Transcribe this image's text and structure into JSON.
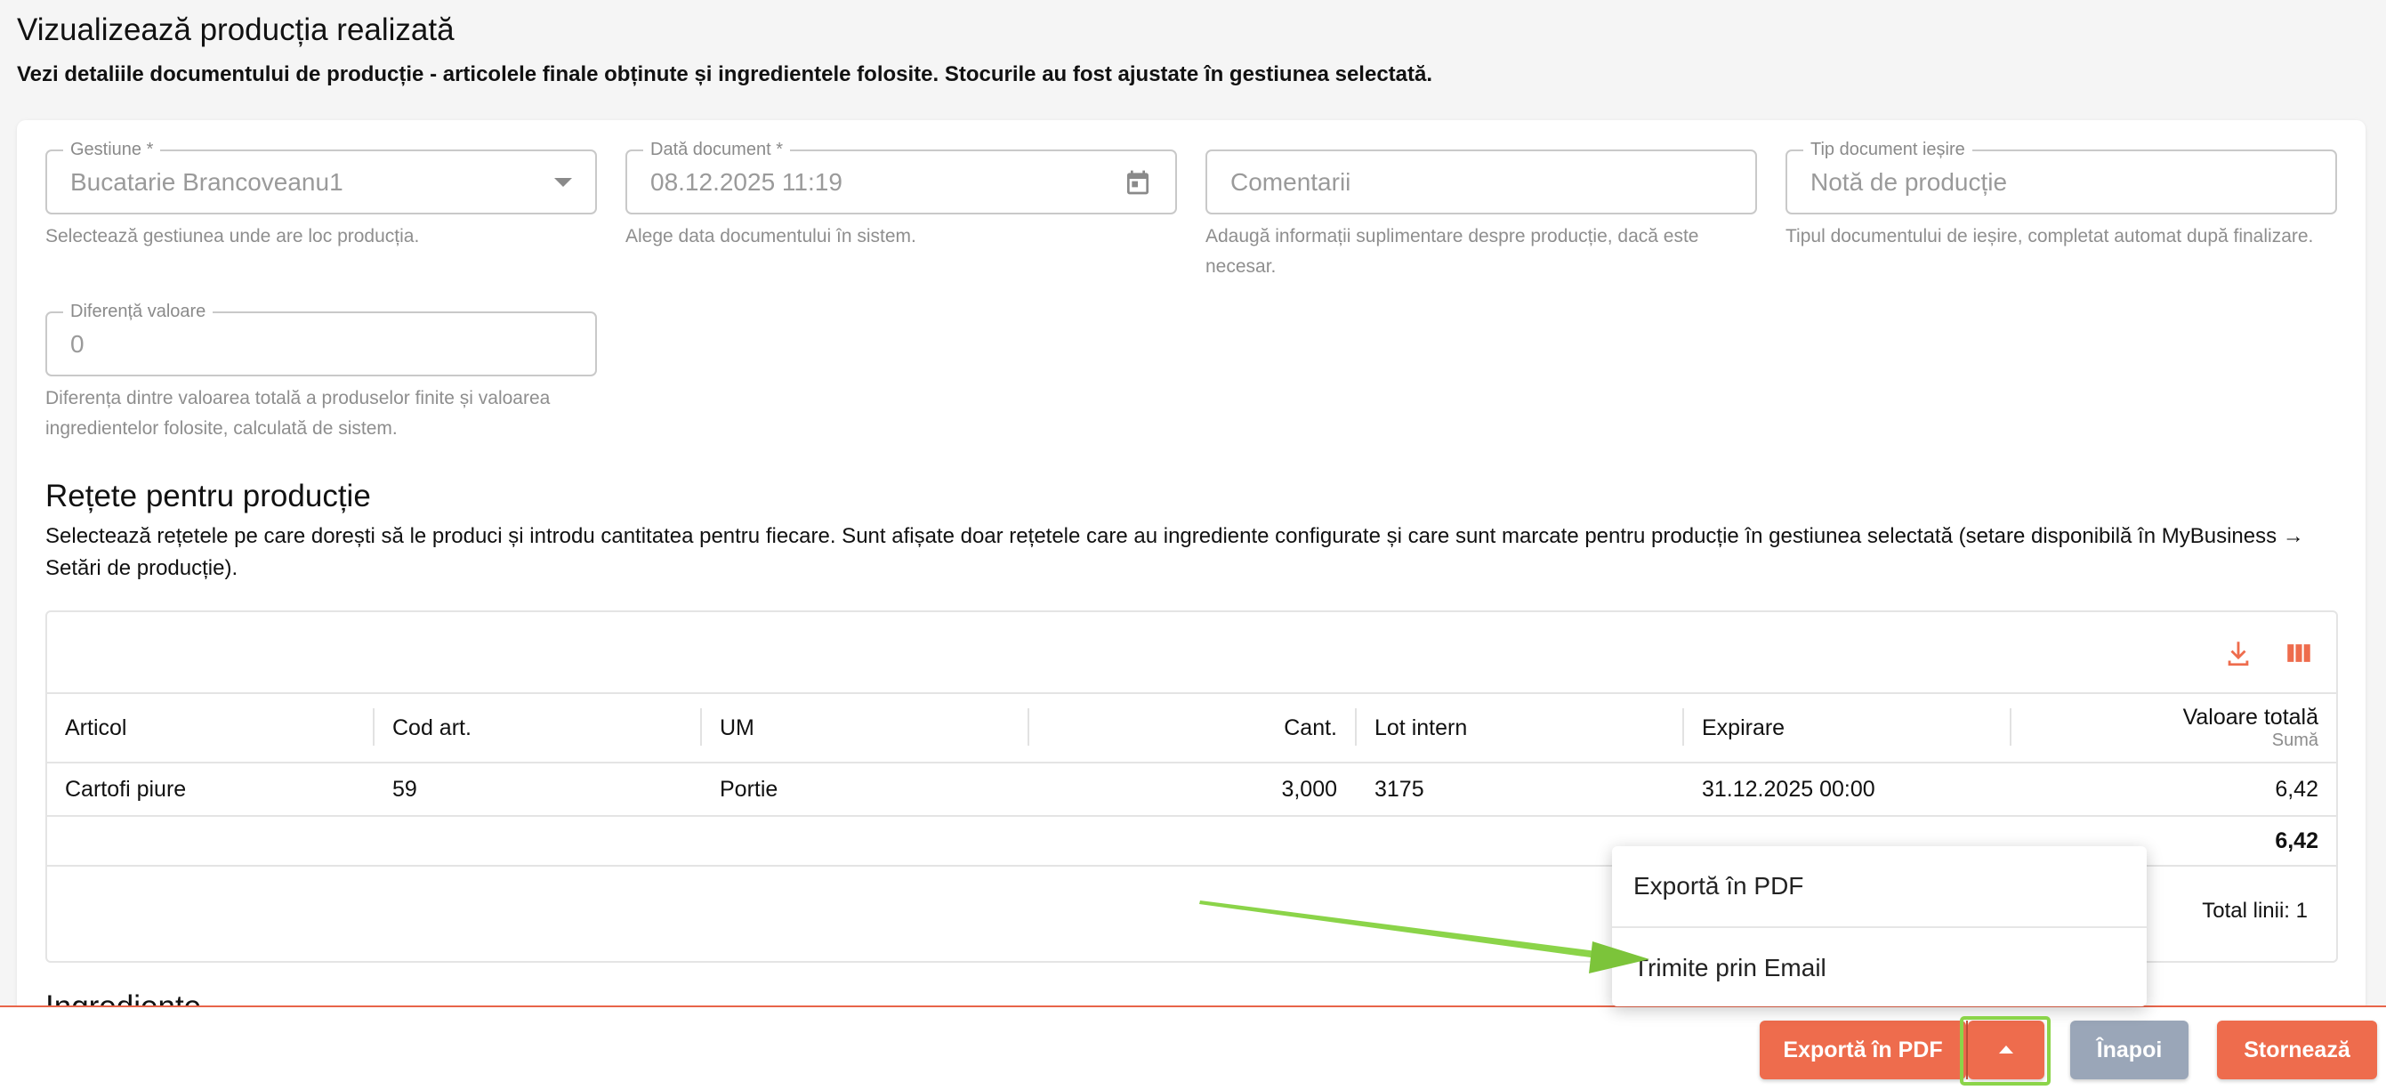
{
  "page": {
    "title": "Vizualizează producția realizată",
    "subtitle": "Vezi detaliile documentului de producție - articolele finale obținute și ingredientele folosite. Stocurile au fost ajustate în gestiunea selectată."
  },
  "form": {
    "gestiune": {
      "label": "Gestiune *",
      "value": "Bucatarie Brancoveanu1",
      "help": "Selectează gestiunea unde are loc producția."
    },
    "data_document": {
      "label": "Dată document *",
      "value": "08.12.2025 11:19",
      "help": "Alege data documentului în sistem."
    },
    "comentarii": {
      "placeholder": "Comentarii",
      "help": "Adaugă informații suplimentare despre producție, dacă este necesar."
    },
    "tip_document": {
      "label": "Tip document ieșire",
      "value": "Notă de producție",
      "help": "Tipul documentului de ieșire, completat automat după finalizare."
    },
    "diferenta": {
      "label": "Diferență valoare",
      "value": "0",
      "help": "Diferența dintre valoarea totală a produselor finite și valoarea ingredientelor folosite, calculată de sistem."
    }
  },
  "recipes": {
    "title": "Rețete pentru producție",
    "description": "Selectează rețetele pe care dorești să le produci și introdu cantitatea pentru fiecare. Sunt afișate doar rețetele care au ingrediente configurate și care sunt marcate pentru producție în gestiunea selectată (setare disponibilă în MyBusiness → Setări de producție)."
  },
  "table": {
    "columns": {
      "articol": "Articol",
      "cod": "Cod art.",
      "um": "UM",
      "cant": "Cant.",
      "lot": "Lot intern",
      "expirare": "Expirare",
      "valoare": "Valoare totală",
      "valoare_sub": "Sumă"
    },
    "rows": [
      {
        "articol": "Cartofi piure",
        "cod": "59",
        "um": "Portie",
        "cant": "3,000",
        "lot": "3175",
        "expirare": "31.12.2025 00:00",
        "valoare": "6,42"
      }
    ],
    "total": "6,42",
    "total_lines": "Total linii: 1"
  },
  "next_section_partial": "Ingrediente",
  "actions": {
    "export_pdf": "Exportă în PDF",
    "back": "Înapoi",
    "storno": "Stornează"
  },
  "menu": {
    "items": [
      "Exportă în PDF",
      "Trimite prin Email"
    ]
  },
  "colors": {
    "accent": "#ee6c4d",
    "secondary": "#9aa6b8",
    "annotation": "#8bd449"
  }
}
